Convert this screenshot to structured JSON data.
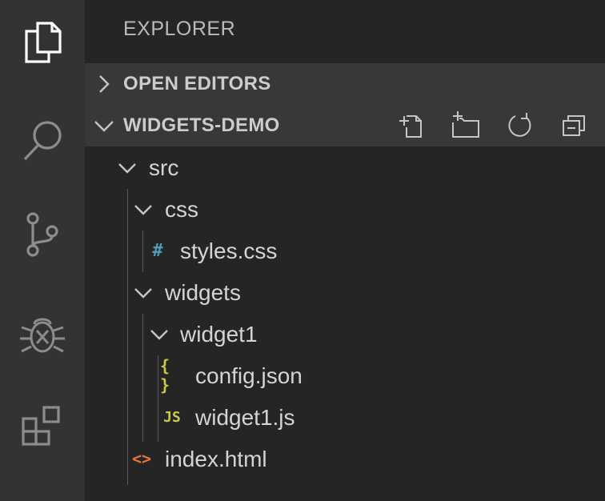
{
  "sidebar": {
    "title": "EXPLORER",
    "sections": {
      "open_editors": "OPEN EDITORS",
      "workspace": "WIDGETS-DEMO"
    }
  },
  "activity_bar": [
    "files-icon",
    "search-icon",
    "source-control-icon",
    "debug-icon",
    "extensions-icon"
  ],
  "toolbar": [
    "new-file-icon",
    "new-folder-icon",
    "refresh-icon",
    "collapse-all-icon"
  ],
  "tree": {
    "src": "src",
    "css": "css",
    "styles": "styles.css",
    "widgets": "widgets",
    "widget1_folder": "widget1",
    "config": "config.json",
    "widget1_js": "widget1.js",
    "index": "index.html"
  },
  "file_icons": {
    "css": "#",
    "json": "{ }",
    "js": "JS",
    "html": "<>"
  },
  "colors": {
    "css_icon": "#519aba",
    "json_icon": "#cbcb41",
    "js_icon": "#cbcb41",
    "html_icon": "#e37933"
  }
}
